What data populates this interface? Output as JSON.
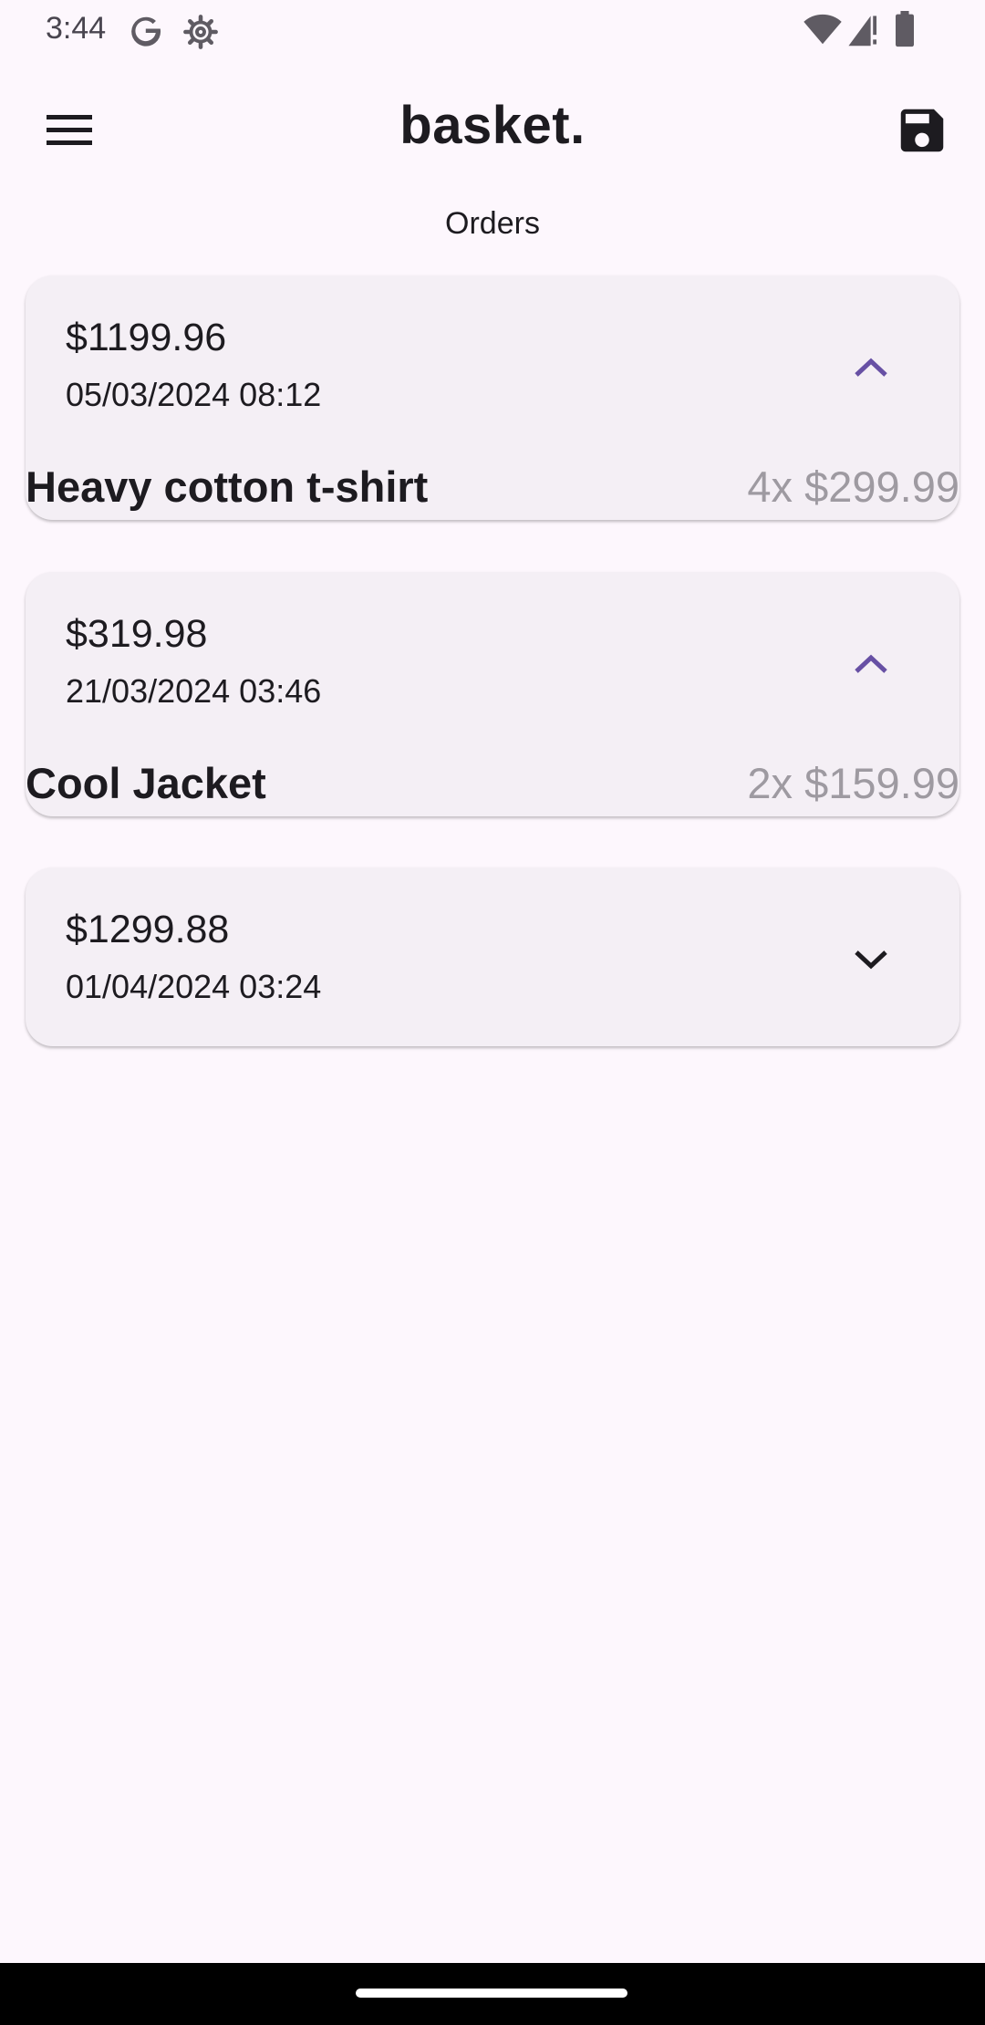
{
  "status_bar": {
    "time": "3:44",
    "icons": [
      "google-icon",
      "settings-gear-icon",
      "wifi-icon",
      "signal-icon",
      "battery-icon"
    ]
  },
  "app_bar": {
    "title": "basket.",
    "menu_icon": "hamburger-menu-icon",
    "save_icon": "save-floppy-icon"
  },
  "section_title": "Orders",
  "colors": {
    "background": "#fdf7fd",
    "card": "#f4eff5",
    "accent": "#6750a4",
    "muted_text": "#9e9aa1"
  },
  "orders": [
    {
      "total": "$1199.96",
      "date": "05/03/2024 08:12",
      "expanded": true,
      "items": [
        {
          "name": "Heavy cotton t-shirt",
          "qty_price": "4x $299.99"
        }
      ]
    },
    {
      "total": "$319.98",
      "date": "21/03/2024 03:46",
      "expanded": true,
      "items": [
        {
          "name": "Cool Jacket",
          "qty_price": "2x $159.99"
        }
      ]
    },
    {
      "total": "$1299.88",
      "date": "01/04/2024 03:24",
      "expanded": false,
      "items": []
    }
  ]
}
